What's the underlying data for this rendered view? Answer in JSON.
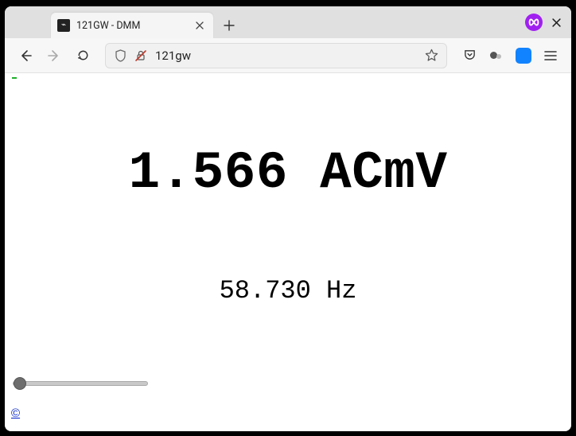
{
  "tab": {
    "title": "121GW - DMM",
    "favicon_glyph": "⌁"
  },
  "toolbar": {
    "url_text": "121gw"
  },
  "readout": {
    "primary": "1.566 ACmV",
    "secondary": "58.730 Hz"
  },
  "slider": {
    "min": 0,
    "max": 100,
    "value": 0
  },
  "footer": {
    "copyright": "©"
  }
}
